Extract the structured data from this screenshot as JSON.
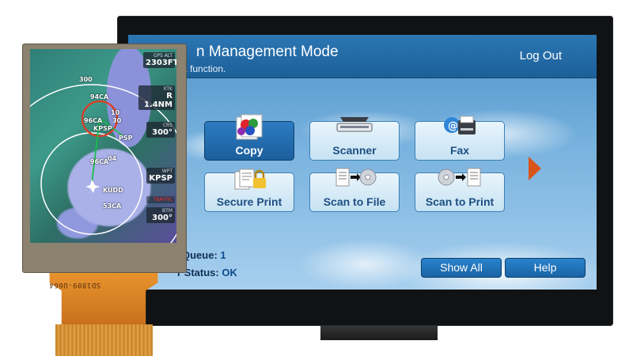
{
  "big_screen": {
    "header": {
      "title": "n Management Mode",
      "subtitle": "a function.",
      "logout_label": "Log Out"
    },
    "tiles": [
      {
        "label": "Copy",
        "icon": "copy-icon",
        "active": true
      },
      {
        "label": "Scanner",
        "icon": "scanner-icon",
        "active": false
      },
      {
        "label": "Fax",
        "icon": "fax-icon",
        "active": false
      },
      {
        "label": "Secure Print",
        "icon": "secure-print-icon",
        "active": false
      },
      {
        "label": "Scan to File",
        "icon": "scan-to-file-icon",
        "active": false
      },
      {
        "label": "Scan to Print",
        "icon": "scan-to-print-icon",
        "active": false
      }
    ],
    "next_page_icon": "chevron-right-icon",
    "status": {
      "queue_label": "Queue:",
      "queue_value": "1",
      "printer_label": "r Status:",
      "printer_value": "OK"
    },
    "buttons": {
      "show_all": "Show All",
      "help": "Help"
    },
    "colors": {
      "header": "#2470ad",
      "accent_arrow": "#d8541a",
      "button": "#1f6db1"
    }
  },
  "small_screen": {
    "gps_alt": {
      "label": "GPS ALT",
      "value": "2303FT"
    },
    "xtk": {
      "label": "XTK",
      "value": "R 1.4NM"
    },
    "crs": {
      "label": "CRS",
      "value": "300°"
    },
    "wpt": {
      "label": "WPT",
      "value": "KPSP"
    },
    "traffic": {
      "label": "TRAFFIC"
    },
    "btm": {
      "label": "BTM",
      "value": "300°"
    },
    "map_labels": {
      "l300": "300",
      "l94ca": "94CA",
      "l96ca": "96CA",
      "l10": "10",
      "l30": "30",
      "kpsp": "KPSP",
      "psp": "PSP",
      "l96ca_b": "96CA",
      "l04": "04",
      "kudd": "KUDD",
      "l53ca": "53CA"
    },
    "flex_print": "SD1809-U664"
  }
}
